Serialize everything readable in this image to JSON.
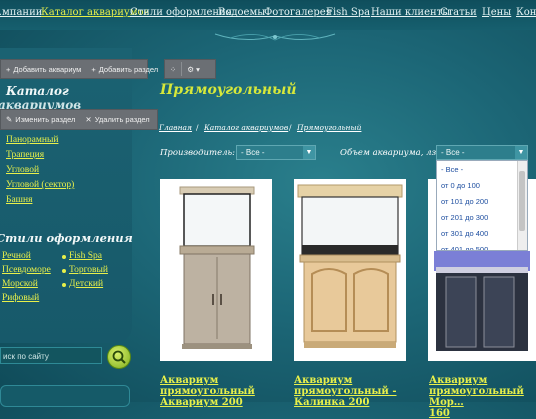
{
  "topnav": {
    "items": [
      "…мпании",
      "Каталог аквариумов",
      "Стили оформления",
      "Водоемы",
      "Фотогалерея",
      "Fish Spa",
      "Наши клиенты",
      "Статьи",
      "Цены",
      "Конт"
    ],
    "active_index": 1
  },
  "admin_toolbar": {
    "add_aquarium": "Добавить аквариум",
    "add_section": "Добавить раздел",
    "edit_section": "Изменить раздел",
    "delete_section": "Удалить раздел"
  },
  "sidebar": {
    "catalog_heading_line1": "Каталог",
    "catalog_heading_line2": "аквариумов",
    "categories": [
      "Панорамный",
      "Трапеция",
      "Угловой",
      "Угловой (сектор)",
      "Башня"
    ],
    "styles_heading": "Стили оформления",
    "styles_left": [
      "Речной",
      "Псевдоморе",
      "Морской",
      "Рифовый"
    ],
    "styles_right": [
      "Fish Spa",
      "Торговый",
      "Детский"
    ],
    "search_placeholder": "иск по сайту"
  },
  "main": {
    "title": "Прямоугольный",
    "breadcrumbs": [
      "Главная",
      "Каталог аквариумов",
      "Прямоугольный"
    ],
    "filter_manufacturer_label": "Производитель:",
    "filter_manufacturer_value": "- Все -",
    "filter_volume_label": "Объем аквариума, лз",
    "filter_volume_value": "- Все -",
    "volume_options": [
      "- Все -",
      "от 0 до 100",
      "от 101 до 200",
      "от 201 до 300",
      "от 301 до 400",
      "от 401 до 500"
    ]
  },
  "products": [
    {
      "line1": "Аквариум",
      "line2": "прямоугольный",
      "line3": "Аквариум 200"
    },
    {
      "line1": "Аквариум",
      "line2": "прямоугольный -",
      "line3": "Калинка 200"
    },
    {
      "line1": "Аквариум",
      "line2": "прямоугольный Мор…",
      "line3": "160"
    }
  ],
  "colors": {
    "accent": "#e8f04a",
    "title": "#d7e83a",
    "bg": "#1c6676"
  }
}
